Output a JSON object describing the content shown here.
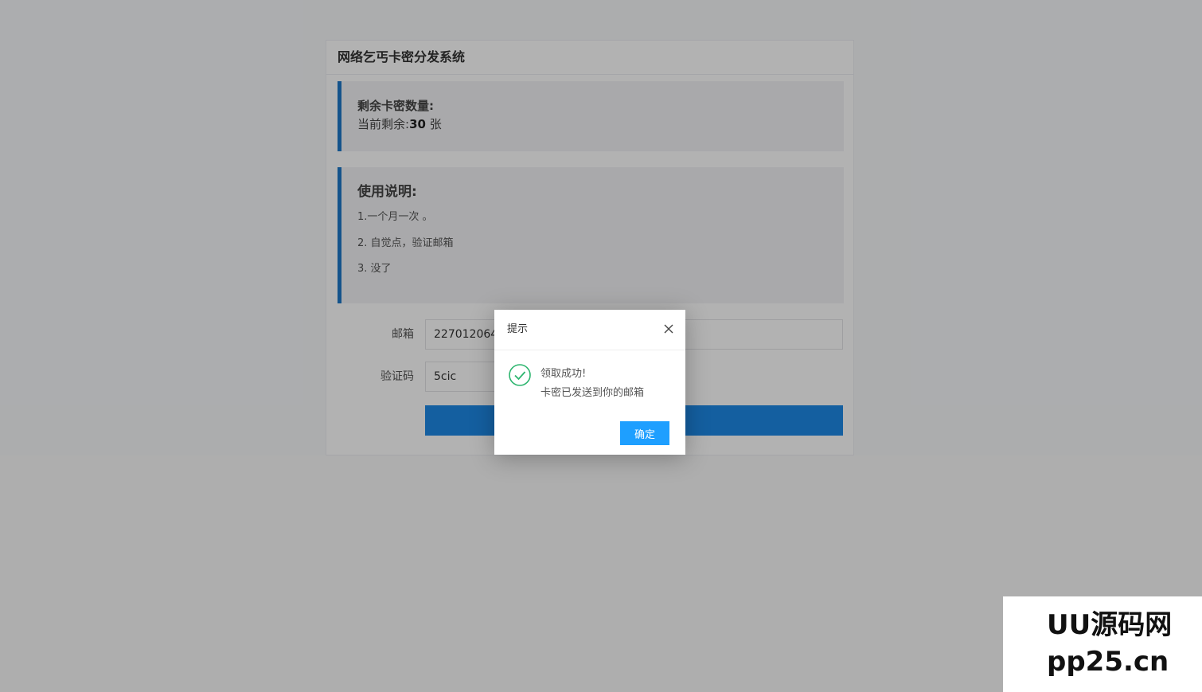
{
  "panel": {
    "title": "网络乞丐卡密分发系统",
    "stock": {
      "title": "剩余卡密数量:",
      "prefix": "当前剩余:",
      "count": "30",
      "unit": " 张"
    },
    "notes": {
      "title": "使用说明:",
      "items": [
        "1.一个月一次 。",
        "2. 自觉点，验证邮箱",
        "3. 没了"
      ]
    },
    "form": {
      "email_label": "邮箱",
      "email_value": "2270120640",
      "captcha_label": "验证码",
      "captcha_value": "5cic",
      "captcha_image_text": "",
      "submit_label": ""
    }
  },
  "dialog": {
    "title": "提示",
    "message_title": "领取成功!",
    "message_body": "卡密已发送到你的邮箱",
    "ok_label": "确定",
    "icon": "check-circle-icon",
    "close_icon": "close-icon"
  },
  "watermark": {
    "line1": "UU源码网",
    "line2": "pp25.cn"
  },
  "colors": {
    "accent": "#1e78c8",
    "button": "#1e9fff",
    "success": "#2db56f"
  }
}
